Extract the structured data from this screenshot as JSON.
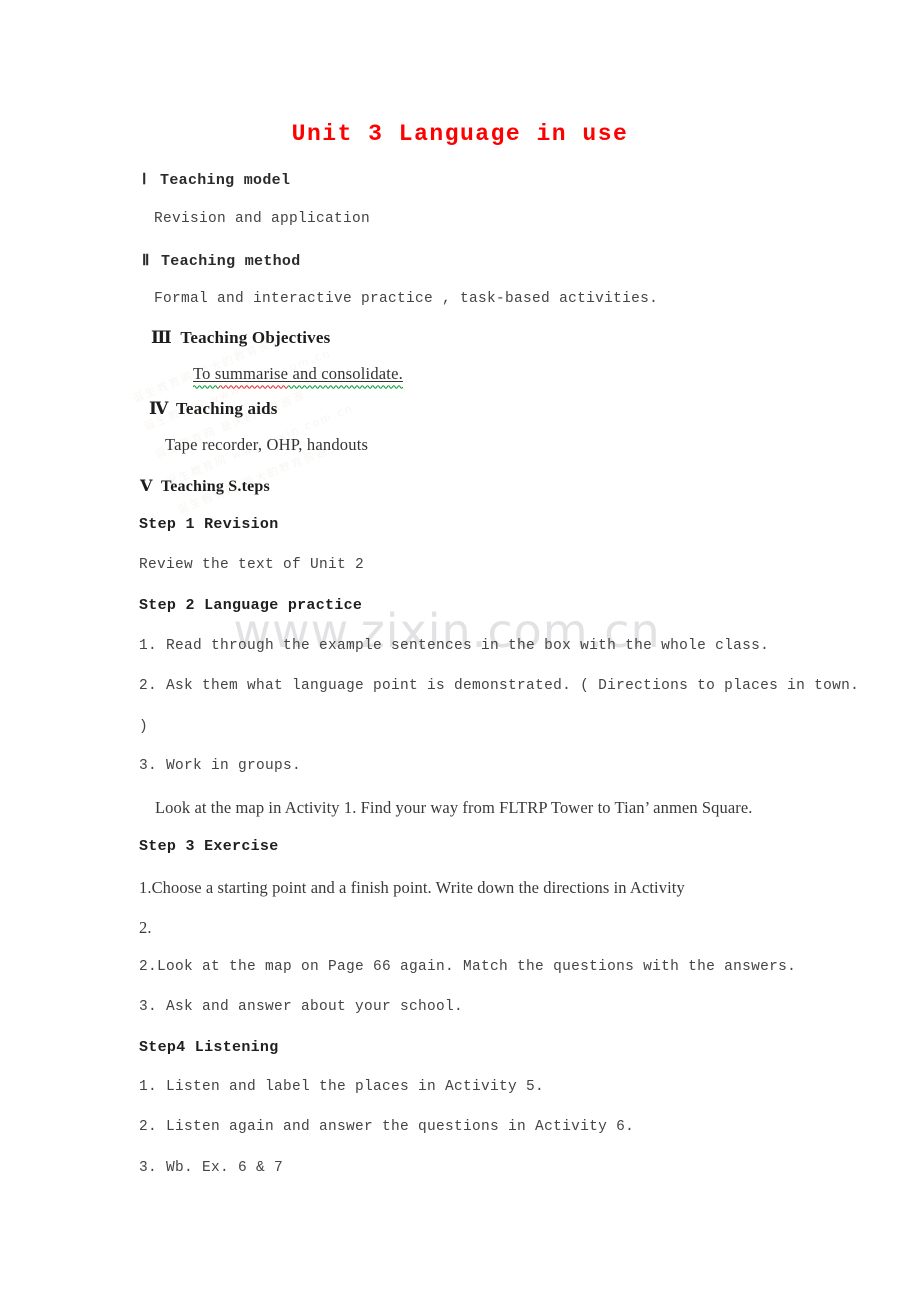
{
  "document": {
    "title": "Unit 3 Language in use",
    "title_color": "#ff0000"
  },
  "watermark": {
    "url": "www.zixin.com.cn",
    "color": "#e2e2e4"
  },
  "sections": [
    {
      "numeral": "Ⅰ",
      "heading": "Teaching model",
      "body": "Revision and application"
    },
    {
      "numeral": "Ⅱ",
      "heading": "Teaching method",
      "body": "Formal and interactive practice ,  task-based activities."
    },
    {
      "numeral": "Ⅲ",
      "heading": "Teaching Objectives",
      "body": "To summarise and consolidate."
    },
    {
      "numeral": "Ⅳ",
      "heading": "Teaching aids",
      "body": "Tape recorder, OHP, handouts"
    },
    {
      "numeral": "Ⅴ",
      "heading": "Teaching S.teps",
      "body": ""
    }
  ],
  "steps": [
    {
      "head": "Step 1 Revision",
      "lines": [
        "Review the text of Unit 2"
      ]
    },
    {
      "head": "Step 2 Language practice",
      "lines": [
        "1. Read through the example sentences in the box with the whole class.",
        "2. Ask them what language point is demonstrated. ( Directions to places in town.",
        ")",
        "3. Work in groups.",
        "Look at the map in Activity 1. Find your way from FLTRP Tower to Tian’ anmen Square."
      ]
    },
    {
      "head": "Step 3 Exercise",
      "lines": [
        "1.Choose a starting point and a finish point. Write down the directions in Activity",
        "2.",
        "2.Look at the map on Page 66 again. Match the questions with the answers.",
        "3. Ask and answer about your school."
      ]
    },
    {
      "head": "Step4 Listening",
      "lines": [
        "1. Listen and label the places in Activity 5.",
        "2. Listen again and answer the questions in Activity 6.",
        "3. Wb. Ex. 6 & 7"
      ]
    }
  ],
  "spellcheck": {
    "underlined_text": "To summarise and consolidate.",
    "misspelled_word": "summarise",
    "grammar_color": "#0a9b2f",
    "spelling_color": "#e03030"
  }
}
